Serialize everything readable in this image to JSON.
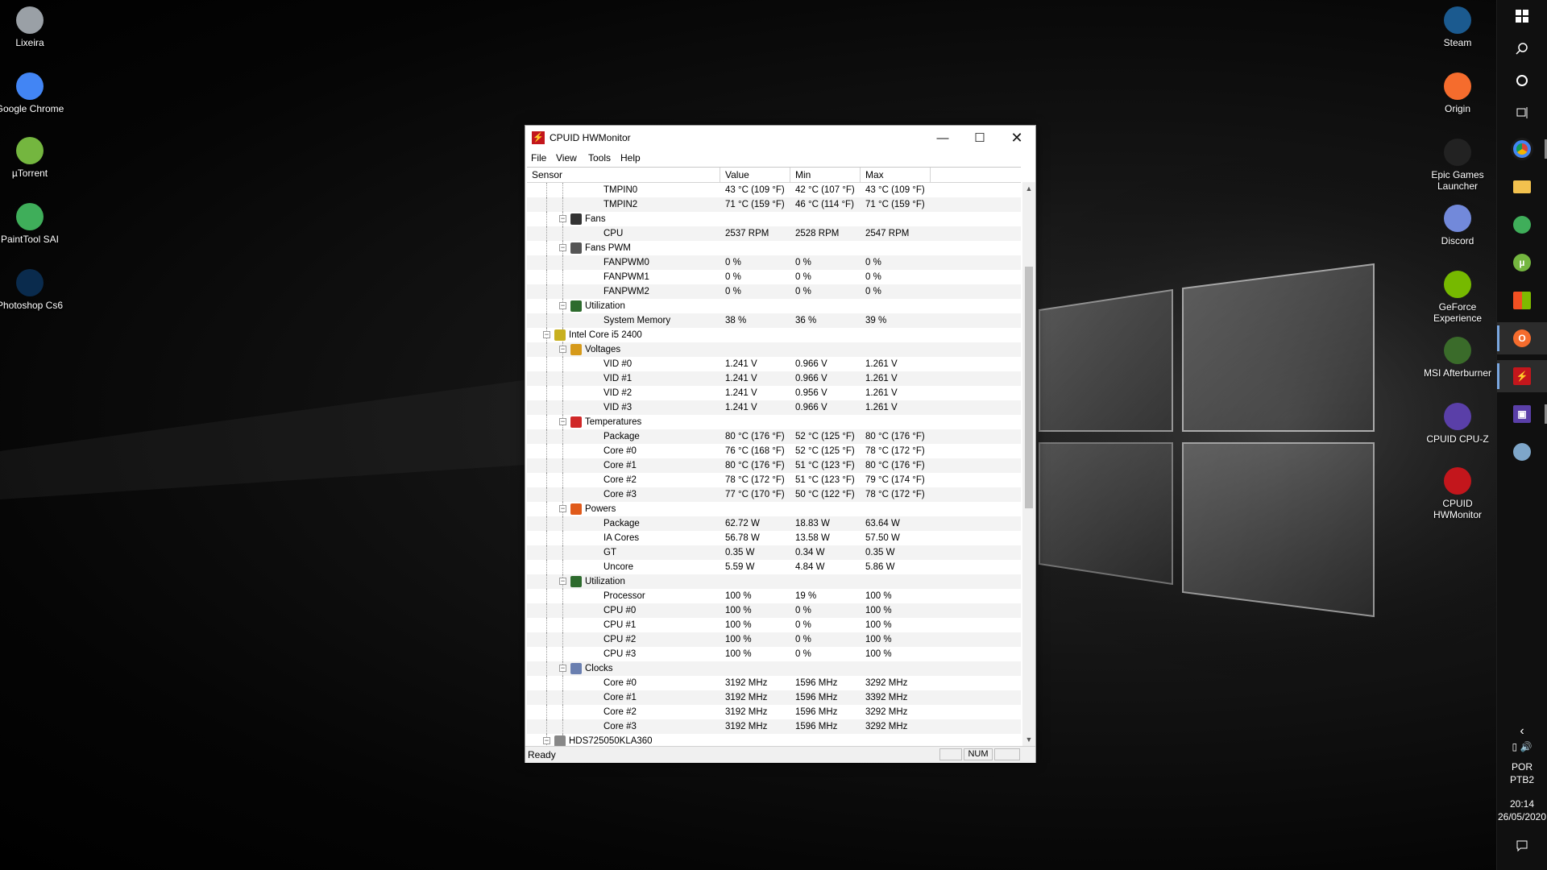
{
  "desktop_left": [
    {
      "label": "Lixeira",
      "icon": "recycle-bin-icon",
      "color": "#9aa0a6"
    },
    {
      "label": "Google Chrome",
      "icon": "chrome-icon",
      "color": "#4285f4"
    },
    {
      "label": "µTorrent",
      "icon": "utorrent-icon",
      "color": "#74b63f"
    },
    {
      "label": "PaintTool SAI",
      "icon": "painttool-sai-icon",
      "color": "#3fae5a"
    },
    {
      "label": "Photoshop Cs6",
      "icon": "photoshop-icon",
      "color": "#0a2b4d"
    }
  ],
  "desktop_right": [
    {
      "label": "Steam",
      "icon": "steam-icon",
      "color": "#1b5a8f"
    },
    {
      "label": "Origin",
      "icon": "origin-icon",
      "color": "#f56c2d"
    },
    {
      "label": "Epic Games Launcher",
      "icon": "epic-games-icon",
      "color": "#222222"
    },
    {
      "label": "Discord",
      "icon": "discord-icon",
      "color": "#7289da"
    },
    {
      "label": "GeForce Experience",
      "icon": "geforce-icon",
      "color": "#76b900"
    },
    {
      "label": "MSI Afterburner",
      "icon": "msi-afterburner-icon",
      "color": "#3a6b2a"
    },
    {
      "label": "CPUID CPU-Z",
      "icon": "cpuz-icon",
      "color": "#5a3fa8"
    },
    {
      "label": "CPUID HWMonitor",
      "icon": "hwmonitor-icon",
      "color": "#c3161c"
    }
  ],
  "taskbar": {
    "tray": {
      "lang1": "POR",
      "lang2": "PTB2",
      "time": "20:14",
      "date": "26/05/2020"
    }
  },
  "window": {
    "title": "CPUID HWMonitor",
    "menu": [
      "File",
      "View",
      "Tools",
      "Help"
    ],
    "columns": [
      "Sensor",
      "Value",
      "Min",
      "Max"
    ],
    "status": {
      "text": "Ready",
      "num": "NUM"
    },
    "rows": [
      {
        "level": 3,
        "label": "TMPIN0",
        "value": "43 °C  (109 °F)",
        "min": "42 °C  (107 °F)",
        "max": "43 °C  (109 °F)"
      },
      {
        "level": 3,
        "label": "TMPIN2",
        "value": "71 °C  (159 °F)",
        "min": "46 °C  (114 °F)",
        "max": "71 °C  (159 °F)"
      },
      {
        "level": 2,
        "label": "Fans",
        "icon": "fan-icon",
        "value": "",
        "min": "",
        "max": ""
      },
      {
        "level": 3,
        "label": "CPU",
        "value": "2537 RPM",
        "min": "2528 RPM",
        "max": "2547 RPM"
      },
      {
        "level": 2,
        "label": "Fans PWM",
        "icon": "fan-pwm-icon",
        "value": "",
        "min": "",
        "max": ""
      },
      {
        "level": 3,
        "label": "FANPWM0",
        "value": "0 %",
        "min": "0 %",
        "max": "0 %"
      },
      {
        "level": 3,
        "label": "FANPWM1",
        "value": "0 %",
        "min": "0 %",
        "max": "0 %"
      },
      {
        "level": 3,
        "label": "FANPWM2",
        "value": "0 %",
        "min": "0 %",
        "max": "0 %"
      },
      {
        "level": 2,
        "label": "Utilization",
        "icon": "utilization-icon",
        "value": "",
        "min": "",
        "max": ""
      },
      {
        "level": 3,
        "label": "System Memory",
        "value": "38 %",
        "min": "36 %",
        "max": "39 %"
      },
      {
        "level": 1,
        "label": "Intel Core i5 2400",
        "icon": "cpu-chip-icon",
        "value": "",
        "min": "",
        "max": ""
      },
      {
        "level": 2,
        "label": "Voltages",
        "icon": "voltage-icon",
        "value": "",
        "min": "",
        "max": ""
      },
      {
        "level": 3,
        "label": "VID #0",
        "value": "1.241 V",
        "min": "0.966 V",
        "max": "1.261 V"
      },
      {
        "level": 3,
        "label": "VID #1",
        "value": "1.241 V",
        "min": "0.966 V",
        "max": "1.261 V"
      },
      {
        "level": 3,
        "label": "VID #2",
        "value": "1.241 V",
        "min": "0.956 V",
        "max": "1.261 V"
      },
      {
        "level": 3,
        "label": "VID #3",
        "value": "1.241 V",
        "min": "0.966 V",
        "max": "1.261 V"
      },
      {
        "level": 2,
        "label": "Temperatures",
        "icon": "thermometer-icon",
        "value": "",
        "min": "",
        "max": ""
      },
      {
        "level": 3,
        "label": "Package",
        "value": "80 °C  (176 °F)",
        "min": "52 °C  (125 °F)",
        "max": "80 °C  (176 °F)"
      },
      {
        "level": 3,
        "label": "Core #0",
        "value": "76 °C  (168 °F)",
        "min": "52 °C  (125 °F)",
        "max": "78 °C  (172 °F)"
      },
      {
        "level": 3,
        "label": "Core #1",
        "value": "80 °C  (176 °F)",
        "min": "51 °C  (123 °F)",
        "max": "80 °C  (176 °F)"
      },
      {
        "level": 3,
        "label": "Core #2",
        "value": "78 °C  (172 °F)",
        "min": "51 °C  (123 °F)",
        "max": "79 °C  (174 °F)"
      },
      {
        "level": 3,
        "label": "Core #3",
        "value": "77 °C  (170 °F)",
        "min": "50 °C  (122 °F)",
        "max": "78 °C  (172 °F)"
      },
      {
        "level": 2,
        "label": "Powers",
        "icon": "power-icon",
        "value": "",
        "min": "",
        "max": ""
      },
      {
        "level": 3,
        "label": "Package",
        "value": "62.72 W",
        "min": "18.83 W",
        "max": "63.64 W"
      },
      {
        "level": 3,
        "label": "IA Cores",
        "value": "56.78 W",
        "min": "13.58 W",
        "max": "57.50 W"
      },
      {
        "level": 3,
        "label": "GT",
        "value": "0.35 W",
        "min": "0.34 W",
        "max": "0.35 W"
      },
      {
        "level": 3,
        "label": "Uncore",
        "value": "5.59 W",
        "min": "4.84 W",
        "max": "5.86 W"
      },
      {
        "level": 2,
        "label": "Utilization",
        "icon": "utilization-icon",
        "value": "",
        "min": "",
        "max": ""
      },
      {
        "level": 3,
        "label": "Processor",
        "value": "100 %",
        "min": "19 %",
        "max": "100 %"
      },
      {
        "level": 3,
        "label": "CPU #0",
        "value": "100 %",
        "min": "0 %",
        "max": "100 %"
      },
      {
        "level": 3,
        "label": "CPU #1",
        "value": "100 %",
        "min": "0 %",
        "max": "100 %"
      },
      {
        "level": 3,
        "label": "CPU #2",
        "value": "100 %",
        "min": "0 %",
        "max": "100 %"
      },
      {
        "level": 3,
        "label": "CPU #3",
        "value": "100 %",
        "min": "0 %",
        "max": "100 %"
      },
      {
        "level": 2,
        "label": "Clocks",
        "icon": "clock-icon",
        "value": "",
        "min": "",
        "max": ""
      },
      {
        "level": 3,
        "label": "Core #0",
        "value": "3192 MHz",
        "min": "1596 MHz",
        "max": "3292 MHz"
      },
      {
        "level": 3,
        "label": "Core #1",
        "value": "3192 MHz",
        "min": "1596 MHz",
        "max": "3392 MHz"
      },
      {
        "level": 3,
        "label": "Core #2",
        "value": "3192 MHz",
        "min": "1596 MHz",
        "max": "3292 MHz"
      },
      {
        "level": 3,
        "label": "Core #3",
        "value": "3192 MHz",
        "min": "1596 MHz",
        "max": "3292 MHz"
      },
      {
        "level": 1,
        "label": "HDS725050KLA360",
        "icon": "hard-drive-icon",
        "value": "",
        "min": "",
        "max": ""
      }
    ]
  }
}
